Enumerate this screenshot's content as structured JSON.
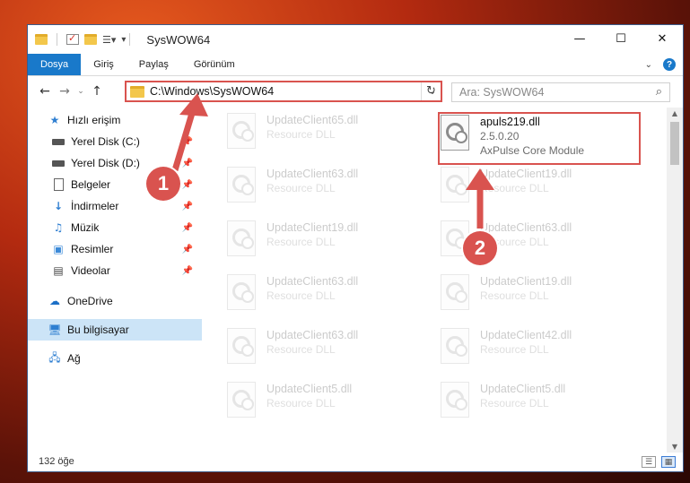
{
  "window": {
    "title": "SysWOW64"
  },
  "window_controls": {
    "minimize": "—",
    "maximize": "☐",
    "close": "✕"
  },
  "ribbon": {
    "tabs": [
      "Dosya",
      "Giriş",
      "Paylaş",
      "Görünüm"
    ]
  },
  "address_bar": {
    "path": "C:\\Windows\\SysWOW64"
  },
  "search": {
    "placeholder": "Ara: SysWOW64"
  },
  "sidebar": {
    "items": [
      {
        "label": "Hızlı erişim",
        "icon": "star-icon"
      },
      {
        "label": "Yerel Disk (C:)",
        "icon": "drive-icon",
        "pinned": true
      },
      {
        "label": "Yerel Disk (D:)",
        "icon": "drive-icon",
        "pinned": true
      },
      {
        "label": "Belgeler",
        "icon": "documents-icon",
        "pinned": true
      },
      {
        "label": "İndirmeler",
        "icon": "download-icon",
        "pinned": true
      },
      {
        "label": "Müzik",
        "icon": "music-icon",
        "pinned": true
      },
      {
        "label": "Resimler",
        "icon": "pictures-icon",
        "pinned": true
      },
      {
        "label": "Videolar",
        "icon": "videos-icon",
        "pinned": true
      },
      {
        "label": "OneDrive",
        "icon": "cloud-icon"
      },
      {
        "label": "Bu bilgisayar",
        "icon": "computer-icon",
        "selected": true
      },
      {
        "label": "Ağ",
        "icon": "network-icon"
      }
    ]
  },
  "files": {
    "left": [
      {
        "name": "UpdateClient65.dll",
        "desc": "Resource DLL"
      },
      {
        "name": "UpdateClient63.dll",
        "desc": "Resource DLL"
      },
      {
        "name": "UpdateClient19.dll",
        "desc": "Resource DLL"
      },
      {
        "name": "UpdateClient63.dll",
        "desc": "Resource DLL"
      },
      {
        "name": "UpdateClient63.dll",
        "desc": "Resource DLL"
      },
      {
        "name": "UpdateClient5.dll",
        "desc": "Resource DLL"
      }
    ],
    "right": [
      {
        "name": "UpdateClient19.dll",
        "desc": "Resource DLL"
      },
      {
        "name": "UpdateClient63.dll",
        "desc": "Resource DLL"
      },
      {
        "name": "UpdateClient19.dll",
        "desc": "Resource DLL"
      },
      {
        "name": "UpdateClient42.dll",
        "desc": "Resource DLL"
      },
      {
        "name": "UpdateClient5.dll",
        "desc": "Resource DLL"
      }
    ],
    "highlighted": {
      "name": "apuls219.dll",
      "version": "2.5.0.20",
      "desc": "AxPulse Core Module"
    }
  },
  "status": {
    "count": "132 öğe"
  },
  "callouts": {
    "one": "1",
    "two": "2"
  },
  "colors": {
    "accent": "#1979ca",
    "highlight": "#d9534f",
    "selected": "#cce4f7"
  }
}
